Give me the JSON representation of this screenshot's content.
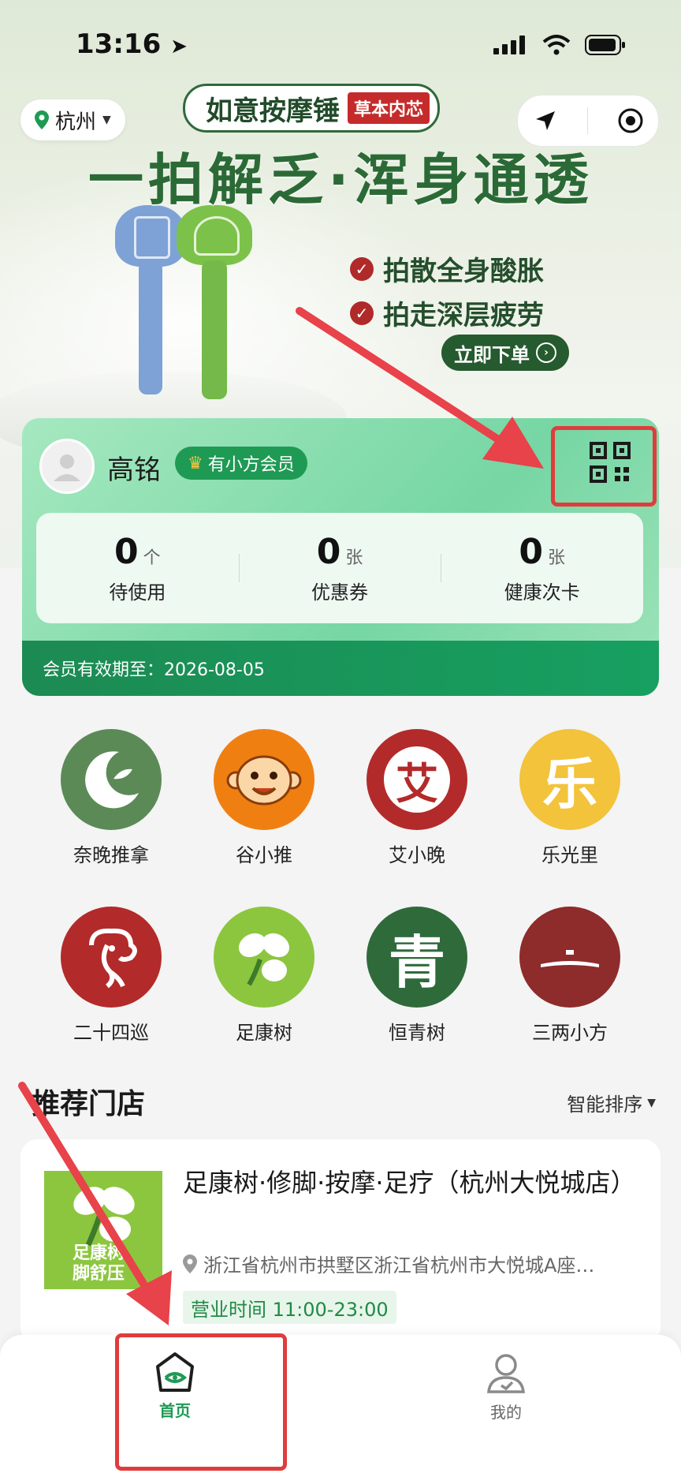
{
  "status_bar": {
    "time": "13:16"
  },
  "banner": {
    "city": "杭州",
    "product_name": "如意按摩锤",
    "product_tag": "草本内芯",
    "slogan": "一拍解乏·浑身通透",
    "features": [
      "拍散全身酸胀",
      "拍走深层疲劳"
    ],
    "order_button": "立即下单"
  },
  "member": {
    "name": "高铭",
    "badge": "有小方会员",
    "stats": [
      {
        "value": "0",
        "unit": "个",
        "label": "待使用"
      },
      {
        "value": "0",
        "unit": "张",
        "label": "优惠券"
      },
      {
        "value": "0",
        "unit": "张",
        "label": "健康次卡"
      }
    ],
    "validity": "会员有效期至：2026-08-05"
  },
  "brands": [
    {
      "name": "奈晚推拿",
      "color": "#5b8a57",
      "icon": "moon-leaf-icon"
    },
    {
      "name": "谷小推",
      "color": "#f07f12",
      "icon": "monkey-icon"
    },
    {
      "name": "艾小晚",
      "color": "#b32a2a",
      "icon": "ai-character-icon",
      "glyph": "艾"
    },
    {
      "name": "乐光里",
      "color": "#f2c33b",
      "icon": "le-character-icon",
      "glyph": "乐"
    },
    {
      "name": "二十四巡",
      "color": "#b32a2a",
      "icon": "koi-icon"
    },
    {
      "name": "足康树",
      "color": "#8cc63f",
      "icon": "clover-icon"
    },
    {
      "name": "恒青树",
      "color": "#2f6a3b",
      "icon": "qing-character-icon",
      "glyph": "青"
    },
    {
      "name": "三两小方",
      "color": "#8e2b2b",
      "icon": "roof-icon"
    }
  ],
  "recommend": {
    "title": "推荐门店",
    "sort_label": "智能排序",
    "store": {
      "name": "足康树·修脚·按摩·足疗（杭州大悦城店）",
      "address": "浙江省杭州市拱墅区浙江省杭州市大悦城A座…",
      "hours": "营业时间 11:00-23:00",
      "thumb_text": "足康树脚舒压"
    }
  },
  "tabbar": {
    "home": "首页",
    "mine": "我的"
  }
}
